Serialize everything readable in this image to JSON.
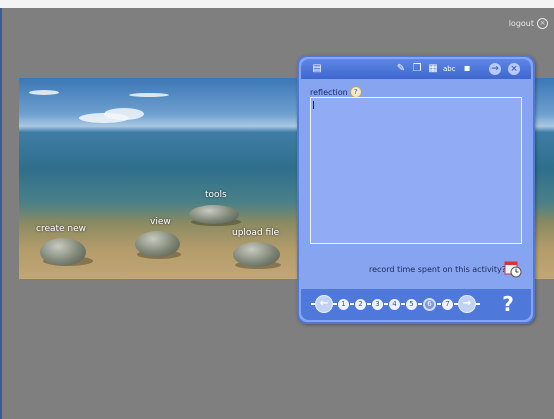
{
  "header": {
    "logout_label": "logout",
    "logout_icon": "close-circle-icon"
  },
  "scene": {
    "items": {
      "create_new": "create new",
      "view": "view",
      "tools": "tools",
      "upload_file": "upload file"
    }
  },
  "panel": {
    "toolbar_icons": [
      "document-icon",
      "edit-icon",
      "copy-icon",
      "paste-icon",
      "spellcheck-icon",
      "save-icon",
      "forward-icon",
      "close-icon"
    ],
    "reflection_label": "reflection",
    "reflection_value": "",
    "record_label": "record time spent on this activity?",
    "pager": {
      "pages": [
        "1",
        "2",
        "3",
        "4",
        "5",
        "6",
        "7"
      ],
      "current": "6"
    },
    "help_label": "?"
  },
  "colors": {
    "panel_bg": "#86a4f0",
    "panel_border": "#4f78d8",
    "page_bg": "#7f7f7f"
  }
}
